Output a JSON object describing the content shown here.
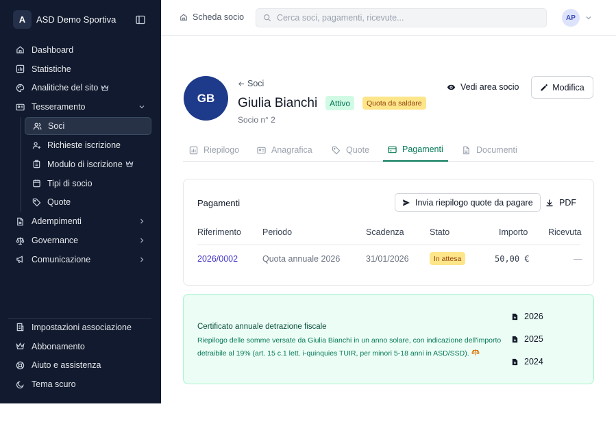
{
  "brand": {
    "initial": "A",
    "name": "ASD Demo Sportiva"
  },
  "sidebar": {
    "nav": [
      {
        "label": "Dashboard",
        "icon": "home-icon"
      },
      {
        "label": "Statistiche",
        "icon": "chart-icon"
      },
      {
        "label": "Analitiche del sito",
        "icon": "palette-icon",
        "premium": true
      },
      {
        "label": "Tesseramento",
        "icon": "id-card-icon",
        "expanded": true
      }
    ],
    "sub": [
      {
        "label": "Soci",
        "icon": "users-icon",
        "active": true
      },
      {
        "label": "Richieste iscrizione",
        "icon": "user-plus-icon"
      },
      {
        "label": "Modulo di iscrizione",
        "icon": "clipboard-icon",
        "premium": true
      },
      {
        "label": "Tipi di socio",
        "icon": "calendar-icon"
      },
      {
        "label": "Quote",
        "icon": "tag-icon"
      }
    ],
    "nav2": [
      {
        "label": "Adempimenti",
        "icon": "file-icon"
      },
      {
        "label": "Governance",
        "icon": "scale-icon"
      },
      {
        "label": "Comunicazione",
        "icon": "megaphone-icon"
      }
    ],
    "bottom": [
      {
        "label": "Impostazioni associazione",
        "icon": "building-icon"
      },
      {
        "label": "Abbonamento",
        "icon": "crown-icon"
      },
      {
        "label": "Aiuto e assistenza",
        "icon": "lifebuoy-icon"
      },
      {
        "label": "Tema scuro",
        "icon": "moon-icon"
      }
    ]
  },
  "topbar": {
    "breadcrumb": "Scheda socio",
    "search_placeholder": "Cerca soci, pagamenti, ricevute...",
    "user_initials": "AP"
  },
  "member": {
    "initials": "GB",
    "back_label": "Soci",
    "name": "Giulia Bianchi",
    "status": "Attivo",
    "fee_status": "Quota da saldare",
    "number": "Socio n° 2",
    "view_area_label": "Vedi area socio",
    "edit_label": "Modifica"
  },
  "tabs": [
    {
      "label": "Riepilogo",
      "icon": "bar-chart-icon"
    },
    {
      "label": "Anagrafica",
      "icon": "contact-card-icon"
    },
    {
      "label": "Quote",
      "icon": "tag-icon"
    },
    {
      "label": "Pagamenti",
      "icon": "credit-card-icon",
      "active": true
    },
    {
      "label": "Documenti",
      "icon": "document-icon"
    }
  ],
  "payments": {
    "title": "Pagamenti",
    "send_label": "Invia riepilogo quote da pagare",
    "pdf_label": "PDF",
    "columns": [
      "Riferimento",
      "Periodo",
      "Scadenza",
      "Stato",
      "Importo",
      "Ricevuta"
    ],
    "rows": [
      {
        "ref": "2026/0002",
        "period": "Quota annuale 2026",
        "due": "31/01/2026",
        "status": "In attesa",
        "amount": "50,00 €",
        "receipt": "—"
      }
    ]
  },
  "certificate": {
    "title": "Certificato annuale detrazione fiscale",
    "description": "Riepilogo delle somme versate da Giulia Bianchi in un anno solare, con indicazione dell'importo detraibile al 19% (art. 15 c.1 lett. i-quinquies TUIR, per minori 5-18 anni in ASD/SSD).",
    "years": [
      "2026",
      "2025",
      "2024"
    ]
  },
  "colors": {
    "sidebar_bg": "#111a2e",
    "accent": "#047857",
    "link": "#4338ca",
    "avatar_bg": "#1e3a8a",
    "warning_bg": "#fde68a"
  }
}
